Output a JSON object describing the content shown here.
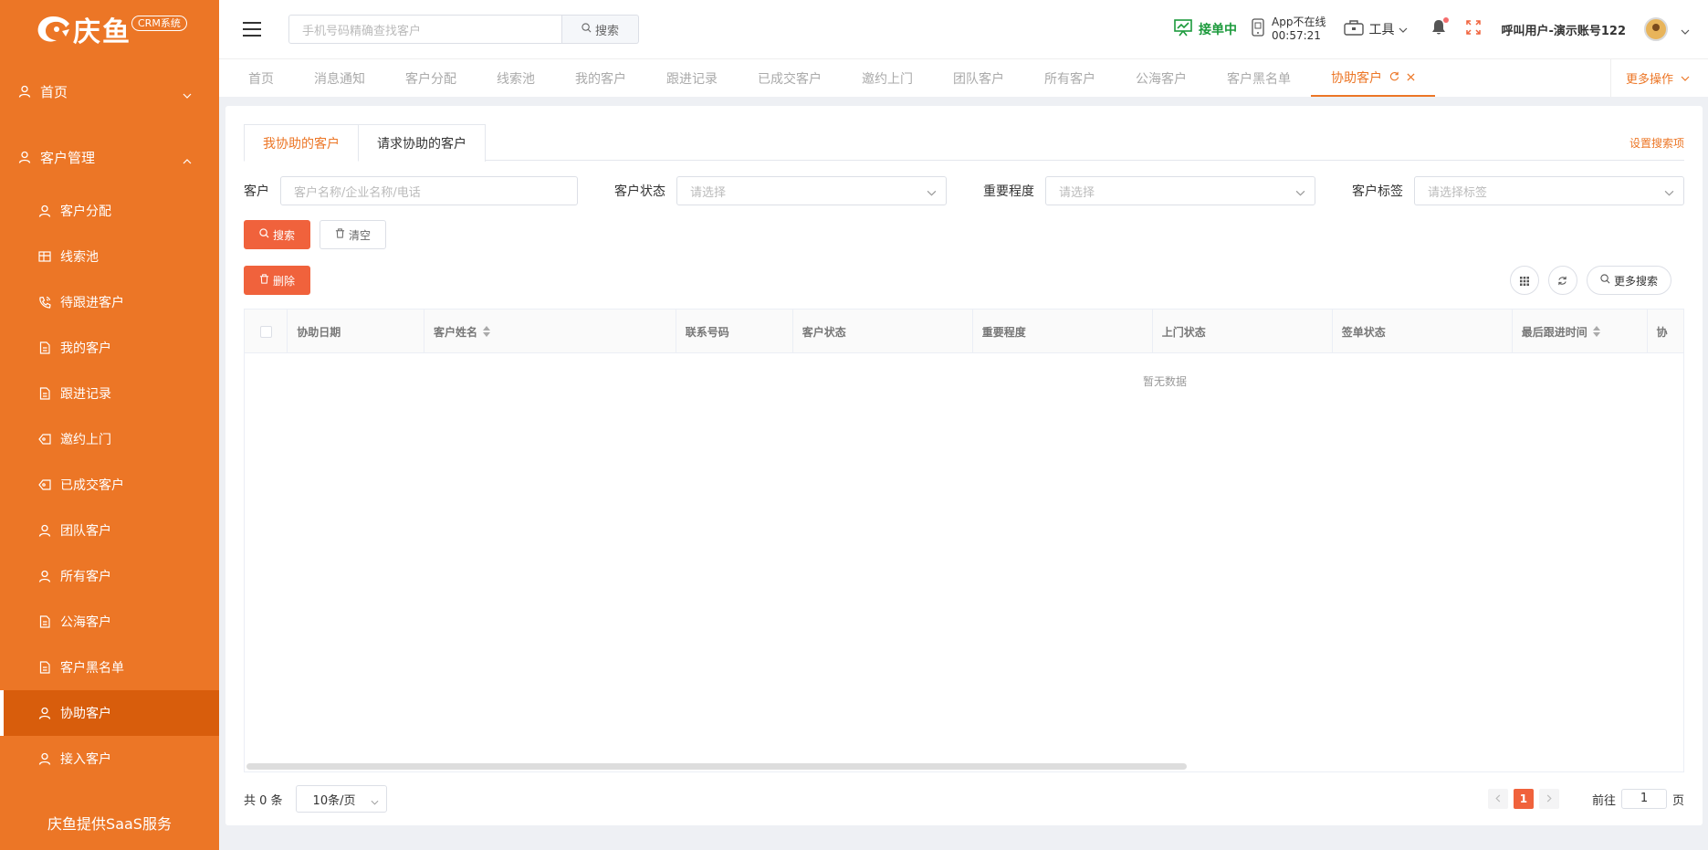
{
  "brand": {
    "name": "庆鱼",
    "badge": "CRM系统",
    "footer": "庆鱼提供SaaS服务",
    "accent": "#ec7626"
  },
  "sidebar": {
    "home": "首页",
    "group": "客户管理",
    "items": [
      {
        "label": "客户分配",
        "icon": "user-icon"
      },
      {
        "label": "线索池",
        "icon": "table-icon"
      },
      {
        "label": "待跟进客户",
        "icon": "phone-icon"
      },
      {
        "label": "我的客户",
        "icon": "document-icon"
      },
      {
        "label": "跟进记录",
        "icon": "document-icon"
      },
      {
        "label": "邀约上门",
        "icon": "tag-icon"
      },
      {
        "label": "已成交客户",
        "icon": "tag-icon"
      },
      {
        "label": "团队客户",
        "icon": "user-icon"
      },
      {
        "label": "所有客户",
        "icon": "user-icon"
      },
      {
        "label": "公海客户",
        "icon": "document-icon"
      },
      {
        "label": "客户黑名单",
        "icon": "document-icon"
      },
      {
        "label": "协助客户",
        "icon": "user-icon",
        "active": true
      },
      {
        "label": "接入客户",
        "icon": "user-icon"
      }
    ]
  },
  "header": {
    "search_placeholder": "手机号码精确查找客户",
    "search_btn": "搜索",
    "jiedan": "接单中",
    "app_status": "App不在线",
    "app_time": "00:57:21",
    "tools": "工具",
    "user": "呼叫用户-演示账号122"
  },
  "tabs": [
    "首页",
    "消息通知",
    "客户分配",
    "线索池",
    "我的客户",
    "跟进记录",
    "已成交客户",
    "邀约上门",
    "团队客户",
    "所有客户",
    "公海客户",
    "客户黑名单"
  ],
  "active_tab": "协助客户",
  "more_ops": "更多操作",
  "subtabs": {
    "a": "我协助的客户",
    "b": "请求协助的客户",
    "settings": "设置搜索项"
  },
  "filters": {
    "customer_label": "客户",
    "customer_ph": "客户名称/企业名称/电话",
    "status_label": "客户状态",
    "status_ph": "请选择",
    "importance_label": "重要程度",
    "importance_ph": "请选择",
    "tag_label": "客户标签",
    "tag_ph": "请选择标签"
  },
  "buttons": {
    "search": "搜索",
    "clear": "清空",
    "delete": "删除",
    "more_search": "更多搜索"
  },
  "table": {
    "columns": [
      "协助日期",
      "客户姓名",
      "联系号码",
      "客户状态",
      "重要程度",
      "上门状态",
      "签单状态",
      "最后跟进时间",
      "协"
    ],
    "empty": "暂无数据"
  },
  "pager": {
    "total": "共 0 条",
    "size": "10条/页",
    "page": "1",
    "goto_pre": "前往",
    "goto_val": "1",
    "goto_post": "页"
  }
}
